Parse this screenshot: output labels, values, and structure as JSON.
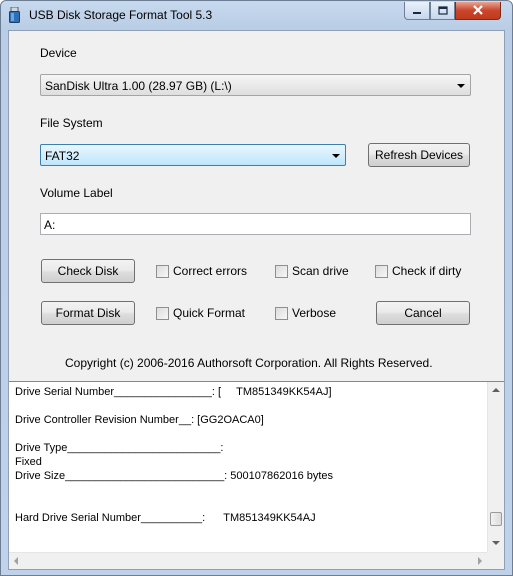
{
  "window": {
    "title": "USB Disk Storage Format Tool 5.3"
  },
  "device": {
    "label": "Device",
    "selected": "SanDisk  Ultra  1.00 (28.97 GB) (L:\\)"
  },
  "filesystem": {
    "label": "File System",
    "selected": "FAT32"
  },
  "buttons": {
    "refresh": "Refresh Devices",
    "check_disk": "Check Disk",
    "format_disk": "Format Disk",
    "cancel": "Cancel"
  },
  "volume": {
    "label": "Volume Label",
    "value": "A:"
  },
  "options": {
    "correct_errors": "Correct errors",
    "scan_drive": "Scan drive",
    "check_if_dirty": "Check if dirty",
    "quick_format": "Quick Format",
    "verbose": "Verbose"
  },
  "copyright": "Copyright (c) 2006-2016 Authorsoft Corporation. All Rights Reserved.",
  "log": {
    "lines": [
      "Drive Serial Number________________: [     TM851349KK54AJ]",
      "Drive Controller Revision Number__: [GG2OACA0]",
      "Drive Type_________________________:",
      "Fixed",
      "Drive Size__________________________: 500107862016 bytes",
      "Hard Drive Serial Number__________:      TM851349KK54AJ"
    ]
  },
  "icons": {
    "app": "usb-drive-icon",
    "minimize": "minimize-icon",
    "maximize": "maximize-icon",
    "close": "close-icon"
  }
}
